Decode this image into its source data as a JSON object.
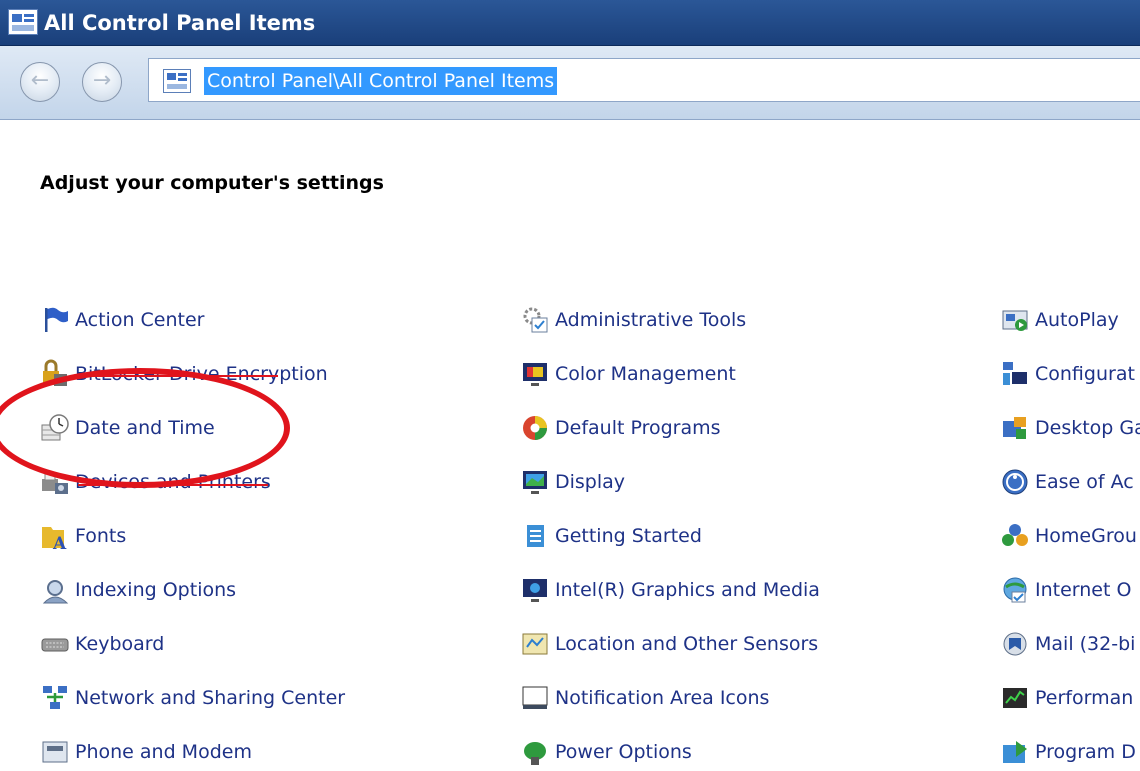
{
  "window": {
    "title": "All Control Panel Items"
  },
  "navigation": {
    "back_glyph": "←",
    "forward_glyph": "→"
  },
  "address": {
    "path": "Control Panel\\All Control Panel Items"
  },
  "heading": "Adjust your computer's settings",
  "items": {
    "col1": [
      {
        "label": "Action Center",
        "icon": "flag-icon"
      },
      {
        "label": "BitLocker Drive Encryption",
        "icon": "bitlocker-icon"
      },
      {
        "label": "Date and Time",
        "icon": "clock-icon"
      },
      {
        "label": "Devices and Printers",
        "icon": "printer-icon"
      },
      {
        "label": "Fonts",
        "icon": "fonts-folder-icon"
      },
      {
        "label": "Indexing Options",
        "icon": "indexing-icon"
      },
      {
        "label": "Keyboard",
        "icon": "keyboard-icon"
      },
      {
        "label": "Network and Sharing Center",
        "icon": "network-icon"
      },
      {
        "label": "Phone and Modem",
        "icon": "phone-icon"
      }
    ],
    "col2": [
      {
        "label": "Administrative Tools",
        "icon": "admin-tools-icon"
      },
      {
        "label": "Color Management",
        "icon": "color-management-icon"
      },
      {
        "label": "Default Programs",
        "icon": "default-programs-icon"
      },
      {
        "label": "Display",
        "icon": "display-icon"
      },
      {
        "label": "Getting Started",
        "icon": "getting-started-icon"
      },
      {
        "label": "Intel(R) Graphics and Media",
        "icon": "intel-graphics-icon"
      },
      {
        "label": "Location and Other Sensors",
        "icon": "sensors-icon"
      },
      {
        "label": "Notification Area Icons",
        "icon": "notification-icon"
      },
      {
        "label": "Power Options",
        "icon": "power-icon"
      }
    ],
    "col3": [
      {
        "label": "AutoPlay",
        "icon": "autoplay-icon"
      },
      {
        "label": "Configurat",
        "icon": "configuration-icon"
      },
      {
        "label": "Desktop Ga",
        "icon": "desktop-gadgets-icon"
      },
      {
        "label": "Ease of Ac",
        "icon": "ease-of-access-icon"
      },
      {
        "label": "HomeGrou",
        "icon": "homegroup-icon"
      },
      {
        "label": "Internet O",
        "icon": "internet-options-icon"
      },
      {
        "label": "Mail (32-bi",
        "icon": "mail-icon"
      },
      {
        "label": "Performan",
        "icon": "performance-icon"
      },
      {
        "label": "Program D",
        "icon": "program-icon"
      }
    ]
  },
  "colors": {
    "title_bar": "#1a3f7a",
    "link": "#1e3287",
    "selection": "#3399ff",
    "annotation": "#e0141c"
  }
}
